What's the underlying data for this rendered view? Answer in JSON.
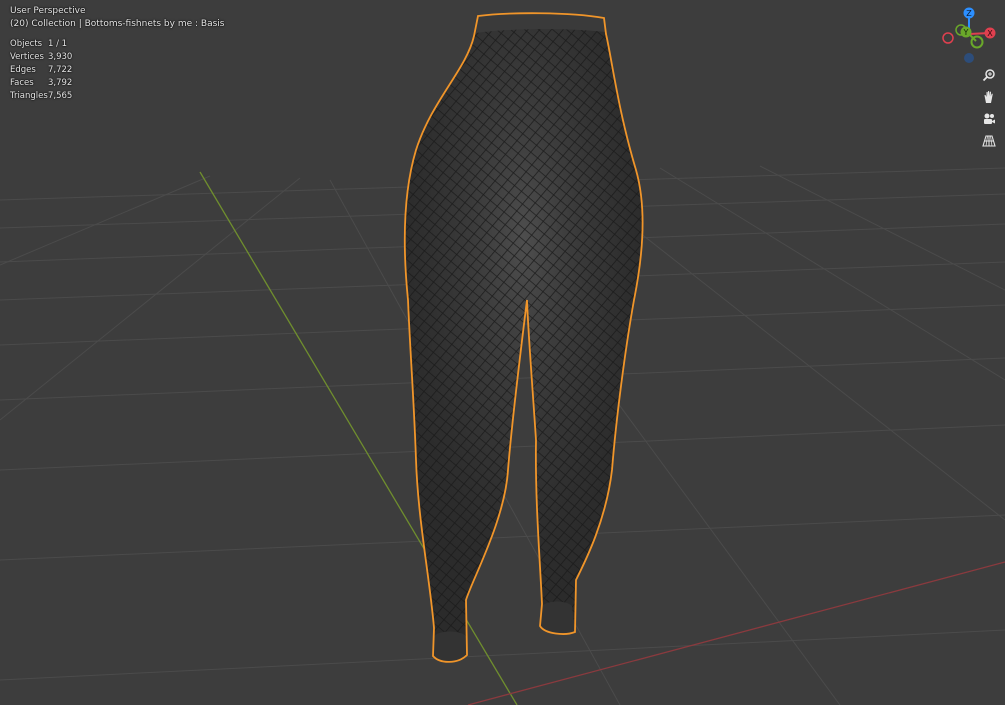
{
  "viewport": {
    "view_name": "User Perspective",
    "collection_line": "(20) Collection | Bottoms-fishnets by me : Basis"
  },
  "statistics": [
    {
      "label": "Objects",
      "value": "1 / 1"
    },
    {
      "label": "Vertices",
      "value": "3,930"
    },
    {
      "label": "Edges",
      "value": "7,722"
    },
    {
      "label": "Faces",
      "value": "3,792"
    },
    {
      "label": "Triangles",
      "value": "7,565"
    }
  ],
  "gizmo": {
    "z_label": "Z",
    "y_label": "Y",
    "x_label": "X",
    "z_color": "#2c8fff",
    "y_color": "#6aa82a",
    "x_color": "#e0404f"
  },
  "nav_tools": [
    {
      "name": "zoom-icon"
    },
    {
      "name": "pan-hand-icon"
    },
    {
      "name": "camera-view-icon"
    },
    {
      "name": "perspective-grid-icon"
    }
  ],
  "colors": {
    "background": "#3d3d3d",
    "grid": "#4d4d4d",
    "x_axis": "#8a3a3e",
    "y_axis": "#6f8e2e",
    "selection_outline": "#f0952a",
    "mesh": "#2b2b2b"
  }
}
